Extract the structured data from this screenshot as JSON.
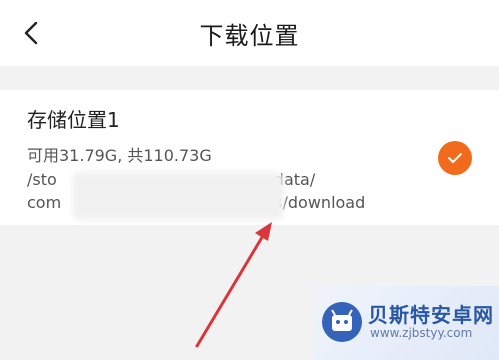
{
  "header": {
    "title": "下载位置",
    "back_icon": "chevron-left-icon"
  },
  "storage_option": {
    "title": "存储位置1",
    "capacity": "可用31.79G, 共110.73G",
    "path_line1_start": "/sto",
    "path_line1_end": "data/",
    "path_line2_start": "com",
    "path_line2_end": "s/download",
    "selected": true,
    "check_color": "#f26a1b"
  },
  "watermark": {
    "name": "贝斯特安卓网",
    "url": "www.zjbstyy.com"
  },
  "colors": {
    "accent": "#f26a1b",
    "annotation_arrow": "#d9353a"
  }
}
